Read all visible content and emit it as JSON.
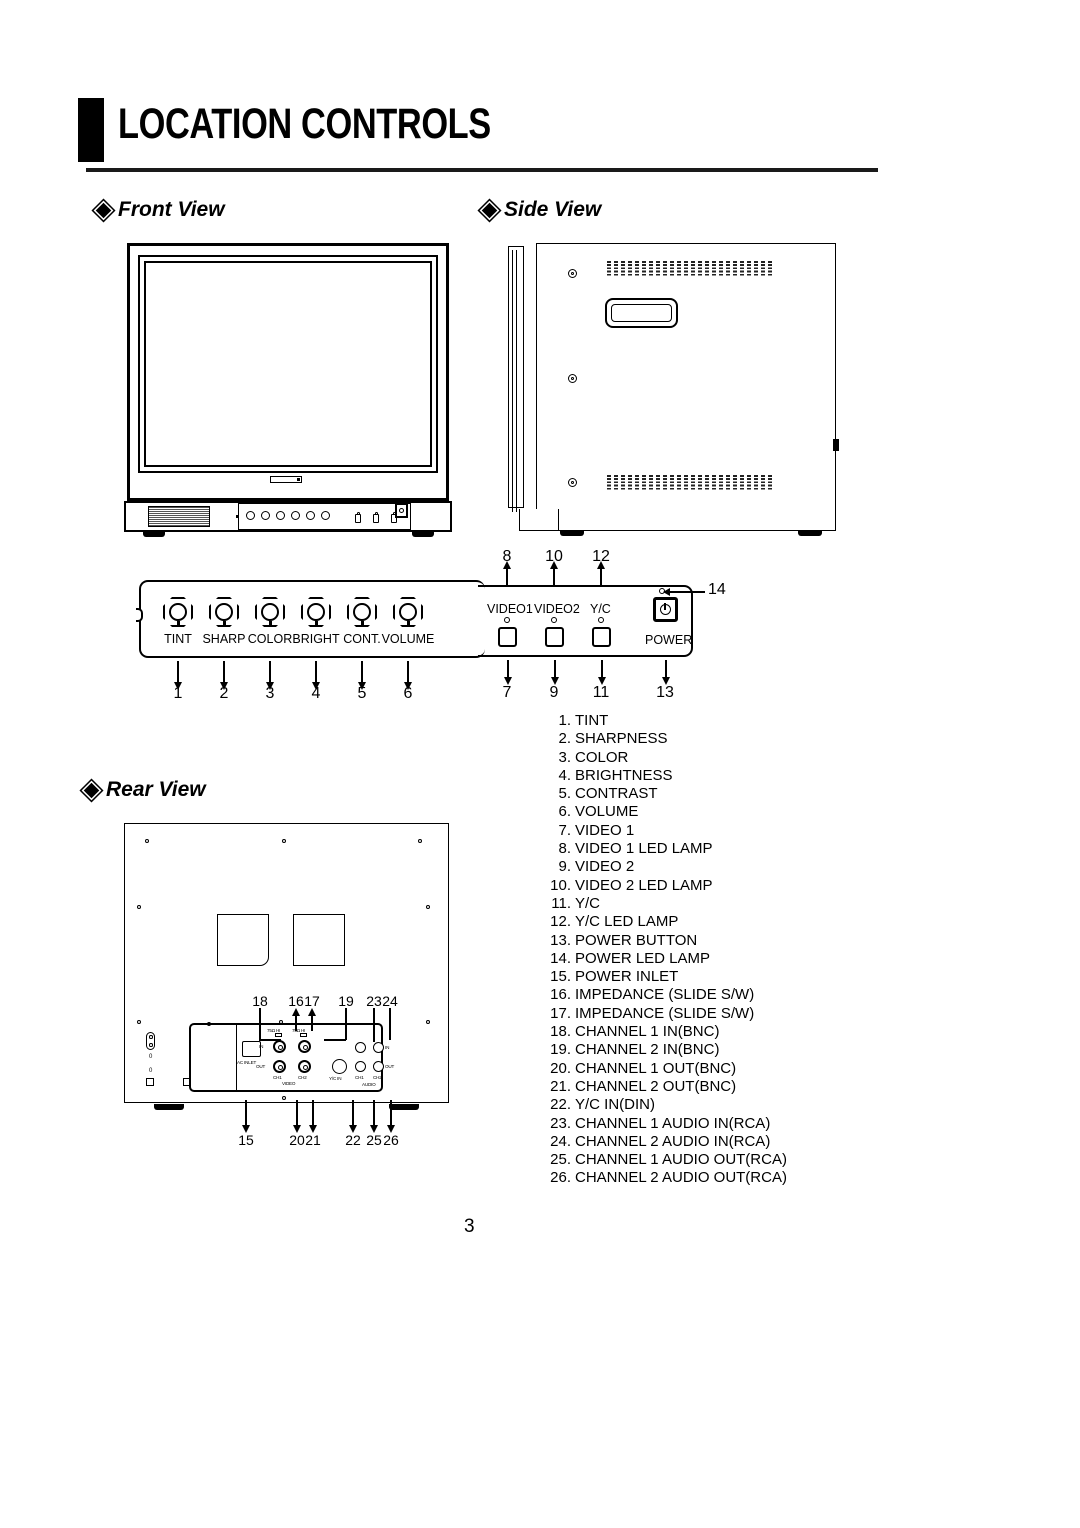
{
  "page": {
    "title": "LOCATION CONTROLS",
    "number": "3"
  },
  "sections": {
    "front": "Front View",
    "side": "Side View",
    "rear": "Rear View"
  },
  "front_panel": {
    "knobs": [
      {
        "label": "TINT",
        "callout": "1"
      },
      {
        "label": "SHARP",
        "callout": "2"
      },
      {
        "label": "COLOR",
        "callout": "3"
      },
      {
        "label": "BRIGHT",
        "callout": "4"
      },
      {
        "label": "CONT.",
        "callout": "5"
      },
      {
        "label": "VOLUME",
        "callout": "6"
      }
    ],
    "inputs": [
      {
        "label": "VIDEO1",
        "button_callout": "7",
        "led_callout": "8"
      },
      {
        "label": "VIDEO2",
        "button_callout": "9",
        "led_callout": "10"
      },
      {
        "label": "Y/C",
        "button_callout": "11",
        "led_callout": "12"
      }
    ],
    "power": {
      "label": "POWER",
      "button_callout": "13",
      "led_callout": "14"
    }
  },
  "rear_panel": {
    "labels": {
      "ac_inlet": "AC INLET",
      "in": "IN",
      "out": "OUT",
      "ch1": "CH1",
      "ch2": "CH2",
      "video": "VIDEO",
      "audio": "AUDIO",
      "yc_in": "Y/C IN",
      "impedance_1": "75Ω HI",
      "impedance_2": "75Ω HI",
      "rca_in": "IN",
      "rca_out": "OUT"
    },
    "callouts_top": [
      "18",
      "16",
      "17",
      "19",
      "23",
      "24"
    ],
    "callouts_bottom": [
      "15",
      "20",
      "21",
      "22",
      "25",
      "26"
    ]
  },
  "legend": [
    {
      "n": "1.",
      "text": "TINT"
    },
    {
      "n": "2.",
      "text": "SHARPNESS"
    },
    {
      "n": "3.",
      "text": "COLOR"
    },
    {
      "n": "4.",
      "text": "BRIGHTNESS"
    },
    {
      "n": "5.",
      "text": "CONTRAST"
    },
    {
      "n": "6.",
      "text": "VOLUME"
    },
    {
      "n": "7.",
      "text": "VIDEO 1"
    },
    {
      "n": "8.",
      "text": "VIDEO 1 LED LAMP"
    },
    {
      "n": "9.",
      "text": "VIDEO  2"
    },
    {
      "n": "10.",
      "text": "VIDEO 2 LED LAMP"
    },
    {
      "n": "11.",
      "text": "Y/C"
    },
    {
      "n": "12.",
      "text": "Y/C LED LAMP"
    },
    {
      "n": "13.",
      "text": "POWER BUTTON"
    },
    {
      "n": "14.",
      "text": "POWER LED LAMP"
    },
    {
      "n": "15.",
      "text": "POWER INLET"
    },
    {
      "n": "16.",
      "text": "IMPEDANCE (SLIDE S/W)"
    },
    {
      "n": "17.",
      "text": "IMPEDANCE (SLIDE S/W)"
    },
    {
      "n": "18.",
      "text": "CHANNEL 1 IN(BNC)"
    },
    {
      "n": "19.",
      "text": "CHANNEL 2 IN(BNC)"
    },
    {
      "n": "20.",
      "text": "CHANNEL 1 OUT(BNC)"
    },
    {
      "n": "21.",
      "text": "CHANNEL 2 OUT(BNC)"
    },
    {
      "n": "22.",
      "text": "Y/C IN(DIN)"
    },
    {
      "n": "23.",
      "text": "CHANNEL 1 AUDIO IN(RCA)"
    },
    {
      "n": "24.",
      "text": "CHANNEL 2 AUDIO IN(RCA)"
    },
    {
      "n": "25.",
      "text": "CHANNEL 1 AUDIO OUT(RCA)"
    },
    {
      "n": "26.",
      "text": "CHANNEL 2 AUDIO OUT(RCA)"
    }
  ],
  "colors": {
    "ink": "#000000",
    "paper": "#ffffff"
  }
}
